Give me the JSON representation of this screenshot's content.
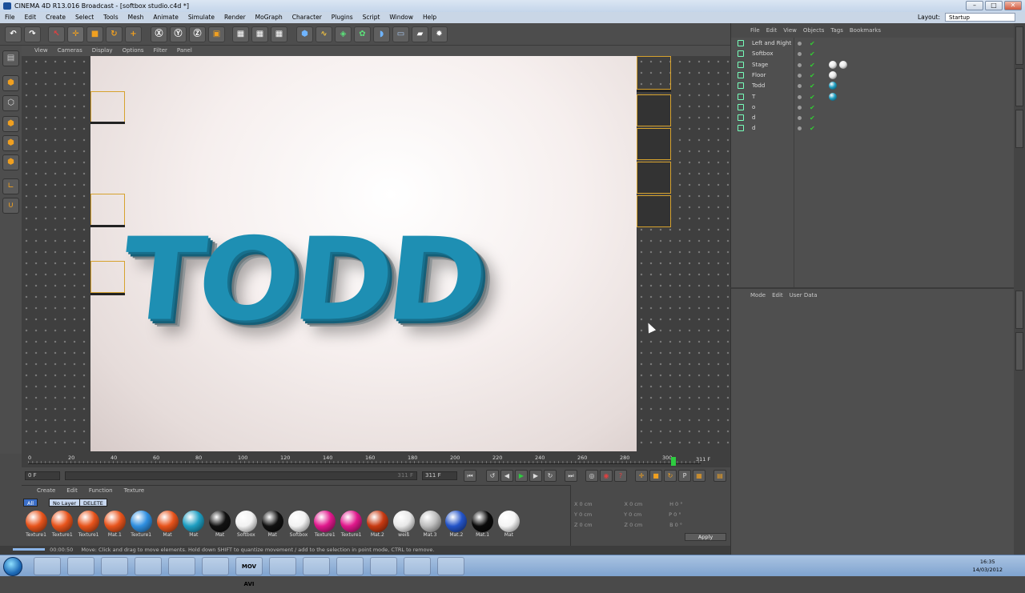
{
  "window": {
    "title": "CINEMA 4D R13.016 Broadcast - [softbox studio.c4d *]",
    "controls": [
      "–",
      "□",
      "✕"
    ]
  },
  "menubar": {
    "items": [
      "File",
      "Edit",
      "Create",
      "Select",
      "Tools",
      "Mesh",
      "Animate",
      "Simulate",
      "Render",
      "MoGraph",
      "Character",
      "Plugins",
      "Script",
      "Window",
      "Help"
    ],
    "layout_label": "Layout:",
    "layout_value": "Startup"
  },
  "viewport": {
    "menu": [
      "View",
      "Cameras",
      "Display",
      "Options",
      "Filter",
      "Panel"
    ],
    "scene_text": "TODD"
  },
  "timeline": {
    "ticks": [
      "0",
      "20",
      "40",
      "60",
      "80",
      "100",
      "120",
      "140",
      "160",
      "180",
      "200",
      "220",
      "240",
      "260",
      "280",
      "300"
    ],
    "end_label": "311 F",
    "progress": 0.965
  },
  "transport": {
    "current_frame": "0 F",
    "slider_end": "311 F",
    "max_frame": "311 F"
  },
  "materials": {
    "menu": [
      "Create",
      "Edit",
      "Function",
      "Texture"
    ],
    "filters": [
      "All",
      "No Layer",
      "DELETE"
    ],
    "items": [
      {
        "label": "Texture1",
        "color": "#e8541c"
      },
      {
        "label": "Texture1",
        "color": "#e8541c"
      },
      {
        "label": "Texture1",
        "color": "#e8541c"
      },
      {
        "label": "Mat.1",
        "color": "#e8541c"
      },
      {
        "label": "Texture1",
        "color": "#2f8fe0"
      },
      {
        "label": "Mat",
        "color": "#e8541c"
      },
      {
        "label": "Mat",
        "color": "#1e9ec2"
      },
      {
        "label": "Mat",
        "color": "#111111"
      },
      {
        "label": "Softbox",
        "color": "#f2f2f2"
      },
      {
        "label": "Mat",
        "color": "#111111"
      },
      {
        "label": "Softbox",
        "color": "#f2f2f2"
      },
      {
        "label": "Texture1",
        "color": "#e0188c"
      },
      {
        "label": "Texture1",
        "color": "#e0188c"
      },
      {
        "label": "Mat.2",
        "color": "#c83a12"
      },
      {
        "label": "weiß",
        "color": "#e8e8e8"
      },
      {
        "label": "Mat.3",
        "color": "#bdbdbd"
      },
      {
        "label": "Mat.2",
        "color": "#2454c8"
      },
      {
        "label": "Mat.1",
        "color": "#0a0a0a"
      },
      {
        "label": "Mat",
        "color": "#f4f4f4"
      }
    ]
  },
  "coordinates": {
    "rows": [
      {
        "a": "X",
        "av": "0 cm",
        "b": "X",
        "bv": "0 cm",
        "c": "H",
        "cv": "0 °"
      },
      {
        "a": "Y",
        "av": "0 cm",
        "b": "Y",
        "bv": "0 cm",
        "c": "P",
        "cv": "0 °"
      },
      {
        "a": "Z",
        "av": "0 cm",
        "b": "Z",
        "bv": "0 cm",
        "c": "B",
        "cv": "0 °"
      }
    ],
    "apply": "Apply"
  },
  "status": {
    "time": "00:00:50",
    "message": "Move: Click and drag to move elements. Hold down SHIFT to quantize movement / add to the selection in point mode, CTRL to remove."
  },
  "objects": {
    "menu": [
      "File",
      "Edit",
      "View",
      "Objects",
      "Tags",
      "Bookmarks"
    ],
    "items": [
      {
        "name": "Left and Right",
        "tags": []
      },
      {
        "name": "Softbox",
        "tags": []
      },
      {
        "name": "Stage",
        "tags": [
          "#e8e8e8",
          "#e8e8e8"
        ]
      },
      {
        "name": "Floor",
        "tags": [
          "#e8e8e8"
        ]
      },
      {
        "name": "Todd",
        "tags": [
          "#1e9ec2"
        ]
      },
      {
        "name": "T",
        "tags": [
          "#1e9ec2"
        ]
      },
      {
        "name": "o",
        "tags": []
      },
      {
        "name": "d",
        "tags": []
      },
      {
        "name": "d",
        "tags": []
      }
    ]
  },
  "attributes": {
    "menu": [
      "Mode",
      "Edit",
      "User Data"
    ]
  },
  "taskbar": {
    "apps": [
      "",
      "",
      "",
      "",
      "",
      "",
      "MOV AVI",
      "",
      "",
      "",
      "",
      "",
      ""
    ],
    "time": "16:35",
    "date": "14/03/2012"
  },
  "colors": {
    "accent": "#f0a020",
    "model": "#1e8fb3"
  }
}
